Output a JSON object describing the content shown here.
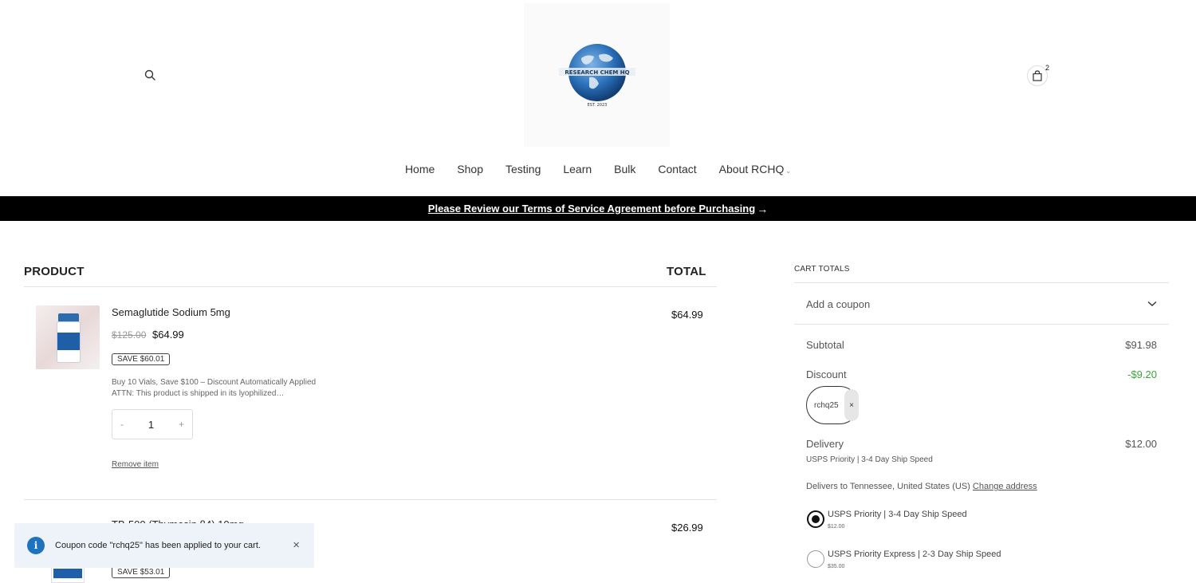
{
  "header": {
    "logo_text": "RESEARCH CHEM HQ",
    "logo_sub": "EST. 2023",
    "cart_count": "2"
  },
  "nav": {
    "items": [
      {
        "label": "Home"
      },
      {
        "label": "Shop"
      },
      {
        "label": "Testing"
      },
      {
        "label": "Learn"
      },
      {
        "label": "Bulk"
      },
      {
        "label": "Contact"
      },
      {
        "label": "About RCHQ"
      }
    ]
  },
  "notice": {
    "text": "Please Review our Terms of Service Agreement before Purchasing",
    "arrow": "→"
  },
  "table": {
    "product_header": "PRODUCT",
    "total_header": "TOTAL"
  },
  "items": [
    {
      "name": "Semaglutide Sodium 5mg",
      "regular_price": "$125.00",
      "sale_price": "$64.99",
      "save_badge": "SAVE $60.01",
      "description_line1": "Buy 10 Vials, Save $100 – Discount Automatically Applied",
      "description_line2": "ATTN: This product is shipped in its lyophilized…",
      "qty_minus": "-",
      "quantity": "1",
      "qty_plus": "+",
      "remove_label": "Remove item",
      "line_total": "$64.99"
    },
    {
      "name": "TB-500 (Thymosin β4) 10mg",
      "save_badge": "SAVE $53.01",
      "line_total": "$26.99"
    }
  ],
  "toast": {
    "icon": "i",
    "message": "Coupon code \"rchq25\" has been applied to your cart.",
    "close": "×"
  },
  "cart_totals": {
    "heading": "CART TOTALS",
    "coupon_toggle": "Add a coupon",
    "subtotal_label": "Subtotal",
    "subtotal_value": "$91.98",
    "discount_label": "Discount",
    "discount_value": "-$9.20",
    "coupon_code": "rchq25",
    "coupon_remove": "×",
    "delivery_label": "Delivery",
    "delivery_value": "$12.00",
    "delivery_method": "USPS Priority | 3-4 Day Ship Speed",
    "delivers_to": "Delivers to Tennessee, United States (US)",
    "change_address": "Change address",
    "shipping_options": [
      {
        "label": "USPS Priority | 3-4 Day Ship Speed",
        "price": "$12.00",
        "selected": true
      },
      {
        "label": "USPS Priority Express | 2-3 Day Ship Speed",
        "price": "$35.00",
        "selected": false
      }
    ]
  },
  "colors": {
    "accent_blue": "#1e73be",
    "discount_green": "#3aa336",
    "notice_bg": "#000000"
  }
}
